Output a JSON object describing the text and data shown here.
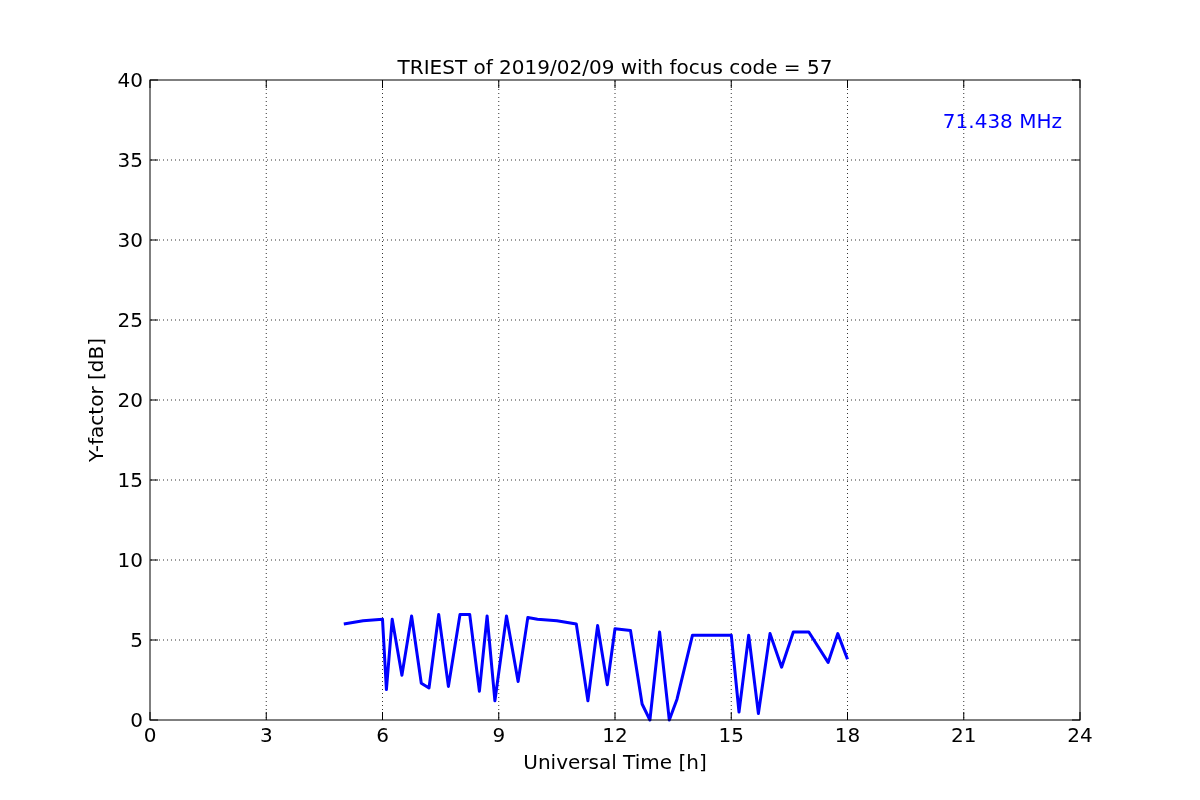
{
  "chart_data": {
    "type": "line",
    "title": "TRIEST of 2019/02/09 with focus code = 57",
    "xlabel": "Universal Time [h]",
    "ylabel": "Y-factor [dB]",
    "x": [
      5,
      5.5,
      6,
      6.1,
      6.25,
      6.5,
      6.75,
      7,
      7.2,
      7.45,
      7.7,
      8,
      8.25,
      8.5,
      8.7,
      8.9,
      9.2,
      9.5,
      9.75,
      10,
      10.5,
      11,
      11.3,
      11.55,
      11.8,
      12,
      12.4,
      12.7,
      12.9,
      13.15,
      13.4,
      13.6,
      14,
      14.5,
      15,
      15.2,
      15.45,
      15.7,
      16,
      16.3,
      16.6,
      17,
      17.5,
      17.75,
      18
    ],
    "series": [
      {
        "name": "71.438 MHz",
        "color": "#0000ff",
        "values": [
          6.0,
          6.2,
          6.3,
          1.9,
          6.3,
          2.8,
          6.5,
          2.3,
          2.0,
          6.6,
          2.1,
          6.6,
          6.6,
          1.8,
          6.5,
          1.2,
          6.5,
          2.4,
          6.4,
          6.3,
          6.2,
          6.0,
          1.2,
          5.9,
          2.2,
          5.7,
          5.6,
          1.0,
          0.0,
          5.5,
          0.0,
          1.3,
          5.3,
          5.3,
          5.3,
          0.5,
          5.3,
          0.4,
          5.4,
          3.3,
          5.5,
          5.5,
          3.6,
          5.4,
          3.8
        ]
      }
    ],
    "grid": true,
    "xlim": [
      0,
      24
    ],
    "ylim": [
      0,
      40
    ],
    "xticks": [
      0,
      3,
      6,
      9,
      12,
      15,
      18,
      21,
      24
    ],
    "yticks": [
      0,
      5,
      10,
      15,
      20,
      25,
      30,
      35,
      40
    ]
  }
}
